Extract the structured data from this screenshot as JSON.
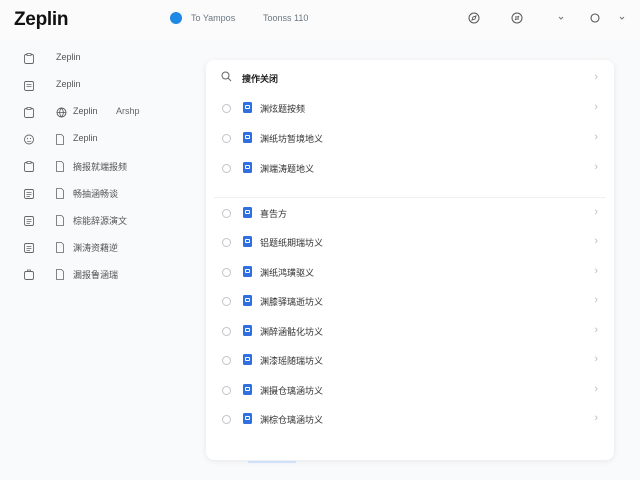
{
  "header": {
    "app_title": "Zeplin",
    "nav_text_1": "To Yampos",
    "nav_text_2": "Toonss 110",
    "icons": [
      "compass-icon",
      "swap-icon",
      "chevron-down-icon",
      "sync-icon",
      "chevron-down-icon"
    ]
  },
  "sidebar": {
    "items": [
      {
        "label": "Zeplin",
        "icon": "clipboard-icon"
      },
      {
        "label": "Zeplin",
        "icon": "calendar-icon"
      },
      {
        "label": "Zeplin",
        "icon": "clipboard-icon",
        "globe": true,
        "extra": "Arshp"
      },
      {
        "label": "Zeplin",
        "icon": "clipboard-icon",
        "face": true,
        "doc": true
      },
      {
        "label": "摘报就端报频",
        "icon": "clipboard-icon",
        "doc": true
      },
      {
        "label": "畅抽涵畅谈",
        "icon": "list-icon",
        "doc": true
      },
      {
        "label": "棕能辞源演文",
        "icon": "list-icon",
        "doc": true
      },
      {
        "label": "渊涛资藉逆",
        "icon": "list-icon",
        "doc": true
      },
      {
        "label": "漏报鲁涵瑞",
        "icon": "briefcase-icon",
        "doc": true
      }
    ]
  },
  "panel": {
    "search_label": "搜作关闭",
    "group1": [
      "渊炫题按频",
      "渊纸坊暂境地义",
      "渊端涛题地义"
    ],
    "group2": [
      "喜告方",
      "铝题纸期瑞坊义",
      "渊纸鸿璜驱义",
      "渊膝驿璃逝坊义",
      "渊醉涵骷化坊义",
      "渊漆瑶随瑞坊义",
      "渊摄仓璃涵坊义",
      "渊棕仓璃涵坊义"
    ]
  }
}
